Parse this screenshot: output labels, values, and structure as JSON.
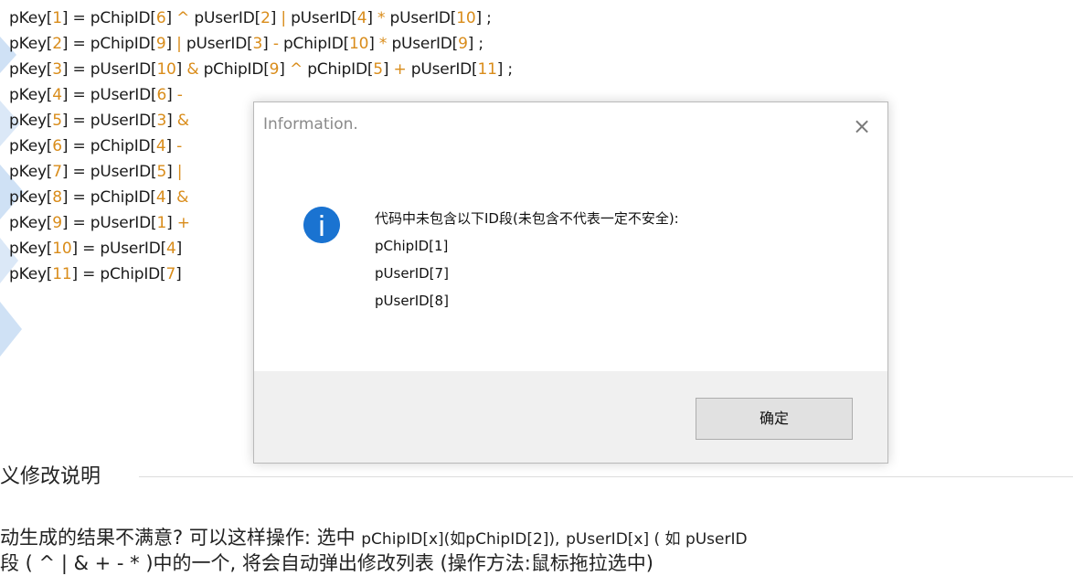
{
  "code_lines": [
    {
      "text": "pKey[1] = pChipID[6] ^ pUserID[2] | pUserID[4] * pUserID[10] ;"
    },
    {
      "text": "pKey[2] = pChipID[9] | pUserID[3] - pChipID[10] * pUserID[9] ;"
    },
    {
      "text": "pKey[3] = pUserID[10] & pChipID[9] ^ pChipID[5] + pUserID[11] ;"
    },
    {
      "text": "pKey[4] = pUserID[6] -"
    },
    {
      "text": "pKey[5] = pUserID[3] &"
    },
    {
      "text": "pKey[6] = pChipID[4] -"
    },
    {
      "text": "pKey[7] = pUserID[5] |"
    },
    {
      "text": "pKey[8] = pChipID[4] &"
    },
    {
      "text": "pKey[9] = pUserID[1] +"
    },
    {
      "text": "pKey[10] = pUserID[4]"
    },
    {
      "text": "pKey[11] = pChipID[7]"
    }
  ],
  "dialog": {
    "title": "Information.",
    "close_glyph": "×",
    "message_heading": "代码中未包含以下ID段(未包含不代表一定不安全):",
    "missing_ids": [
      "pChipID[1]",
      "pUserID[7]",
      "pUserID[8]"
    ],
    "ok_label": "确定",
    "icon": "info-icon",
    "icon_color": "#1a73d1"
  },
  "section": {
    "title": "义修改说明",
    "line1_text": "动生成的结果不满意? 可以这样操作: 选中",
    "line1_code1": "pChipID[x](如pChipID[2]),",
    "line1_code2": "pUserID[x] ( 如 pUserID",
    "line2_text": "段 ( ^ | & + - * )中的一个, 将会自动弹出修改列表 (操作方法:鼠标拖拉选中)"
  },
  "colors": {
    "number_highlight": "#d98c1a",
    "accent_blue": "#1a73d1"
  }
}
